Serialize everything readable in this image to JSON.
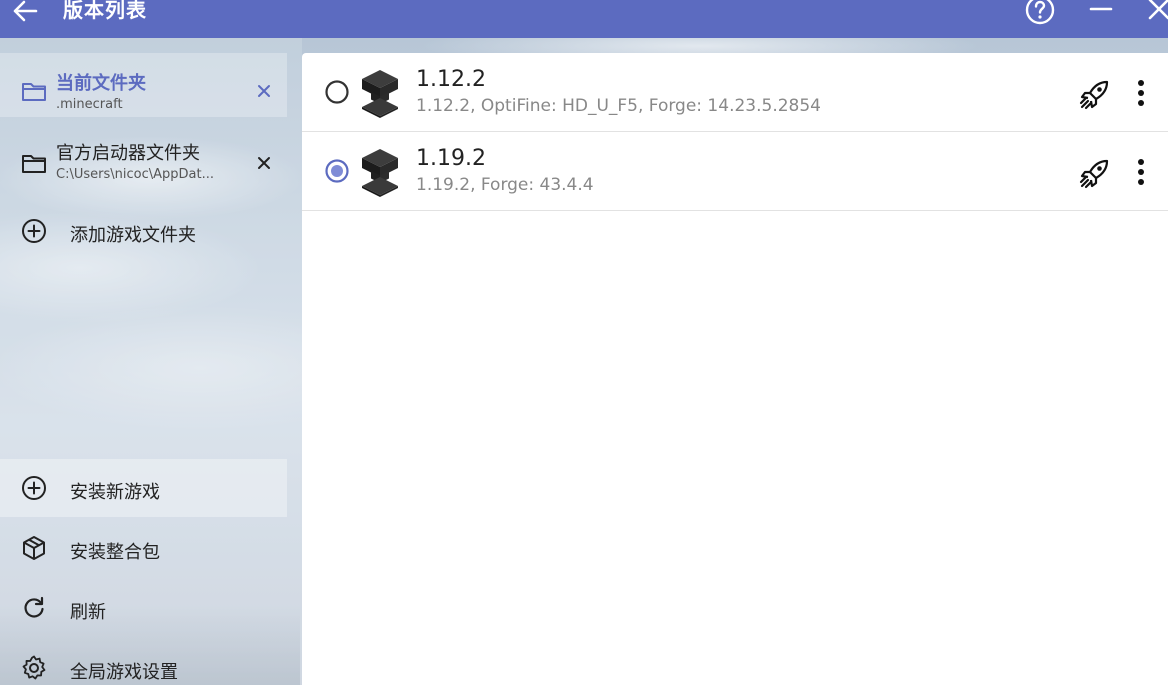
{
  "titlebar": {
    "title": "版本列表",
    "back_icon": "back-arrow-icon",
    "help_icon": "help-icon",
    "minimize_icon": "minimize-icon",
    "close_icon": "close-icon"
  },
  "colors": {
    "accent": "#5c6bc0",
    "text": "#222222",
    "subtext": "#888888"
  },
  "sidebar": {
    "folders": [
      {
        "label": "当前文件夹",
        "path": ".minecraft",
        "selected": true
      },
      {
        "label": "官方启动器文件夹",
        "path": "C:\\Users\\nicoc\\AppDat...",
        "selected": false
      }
    ],
    "add_folder_label": "添加游戏文件夹",
    "actions": [
      {
        "label": "安装新游戏",
        "icon": "plus-circle-icon"
      },
      {
        "label": "安装整合包",
        "icon": "package-icon"
      },
      {
        "label": "刷新",
        "icon": "refresh-icon"
      },
      {
        "label": "全局游戏设置",
        "icon": "gear-icon"
      }
    ]
  },
  "versions": [
    {
      "name": "1.12.2",
      "description": "1.12.2, OptiFine: HD_U_F5, Forge: 14.23.5.2854",
      "selected": false
    },
    {
      "name": "1.19.2",
      "description": "1.19.2, Forge: 43.4.4",
      "selected": true
    }
  ]
}
